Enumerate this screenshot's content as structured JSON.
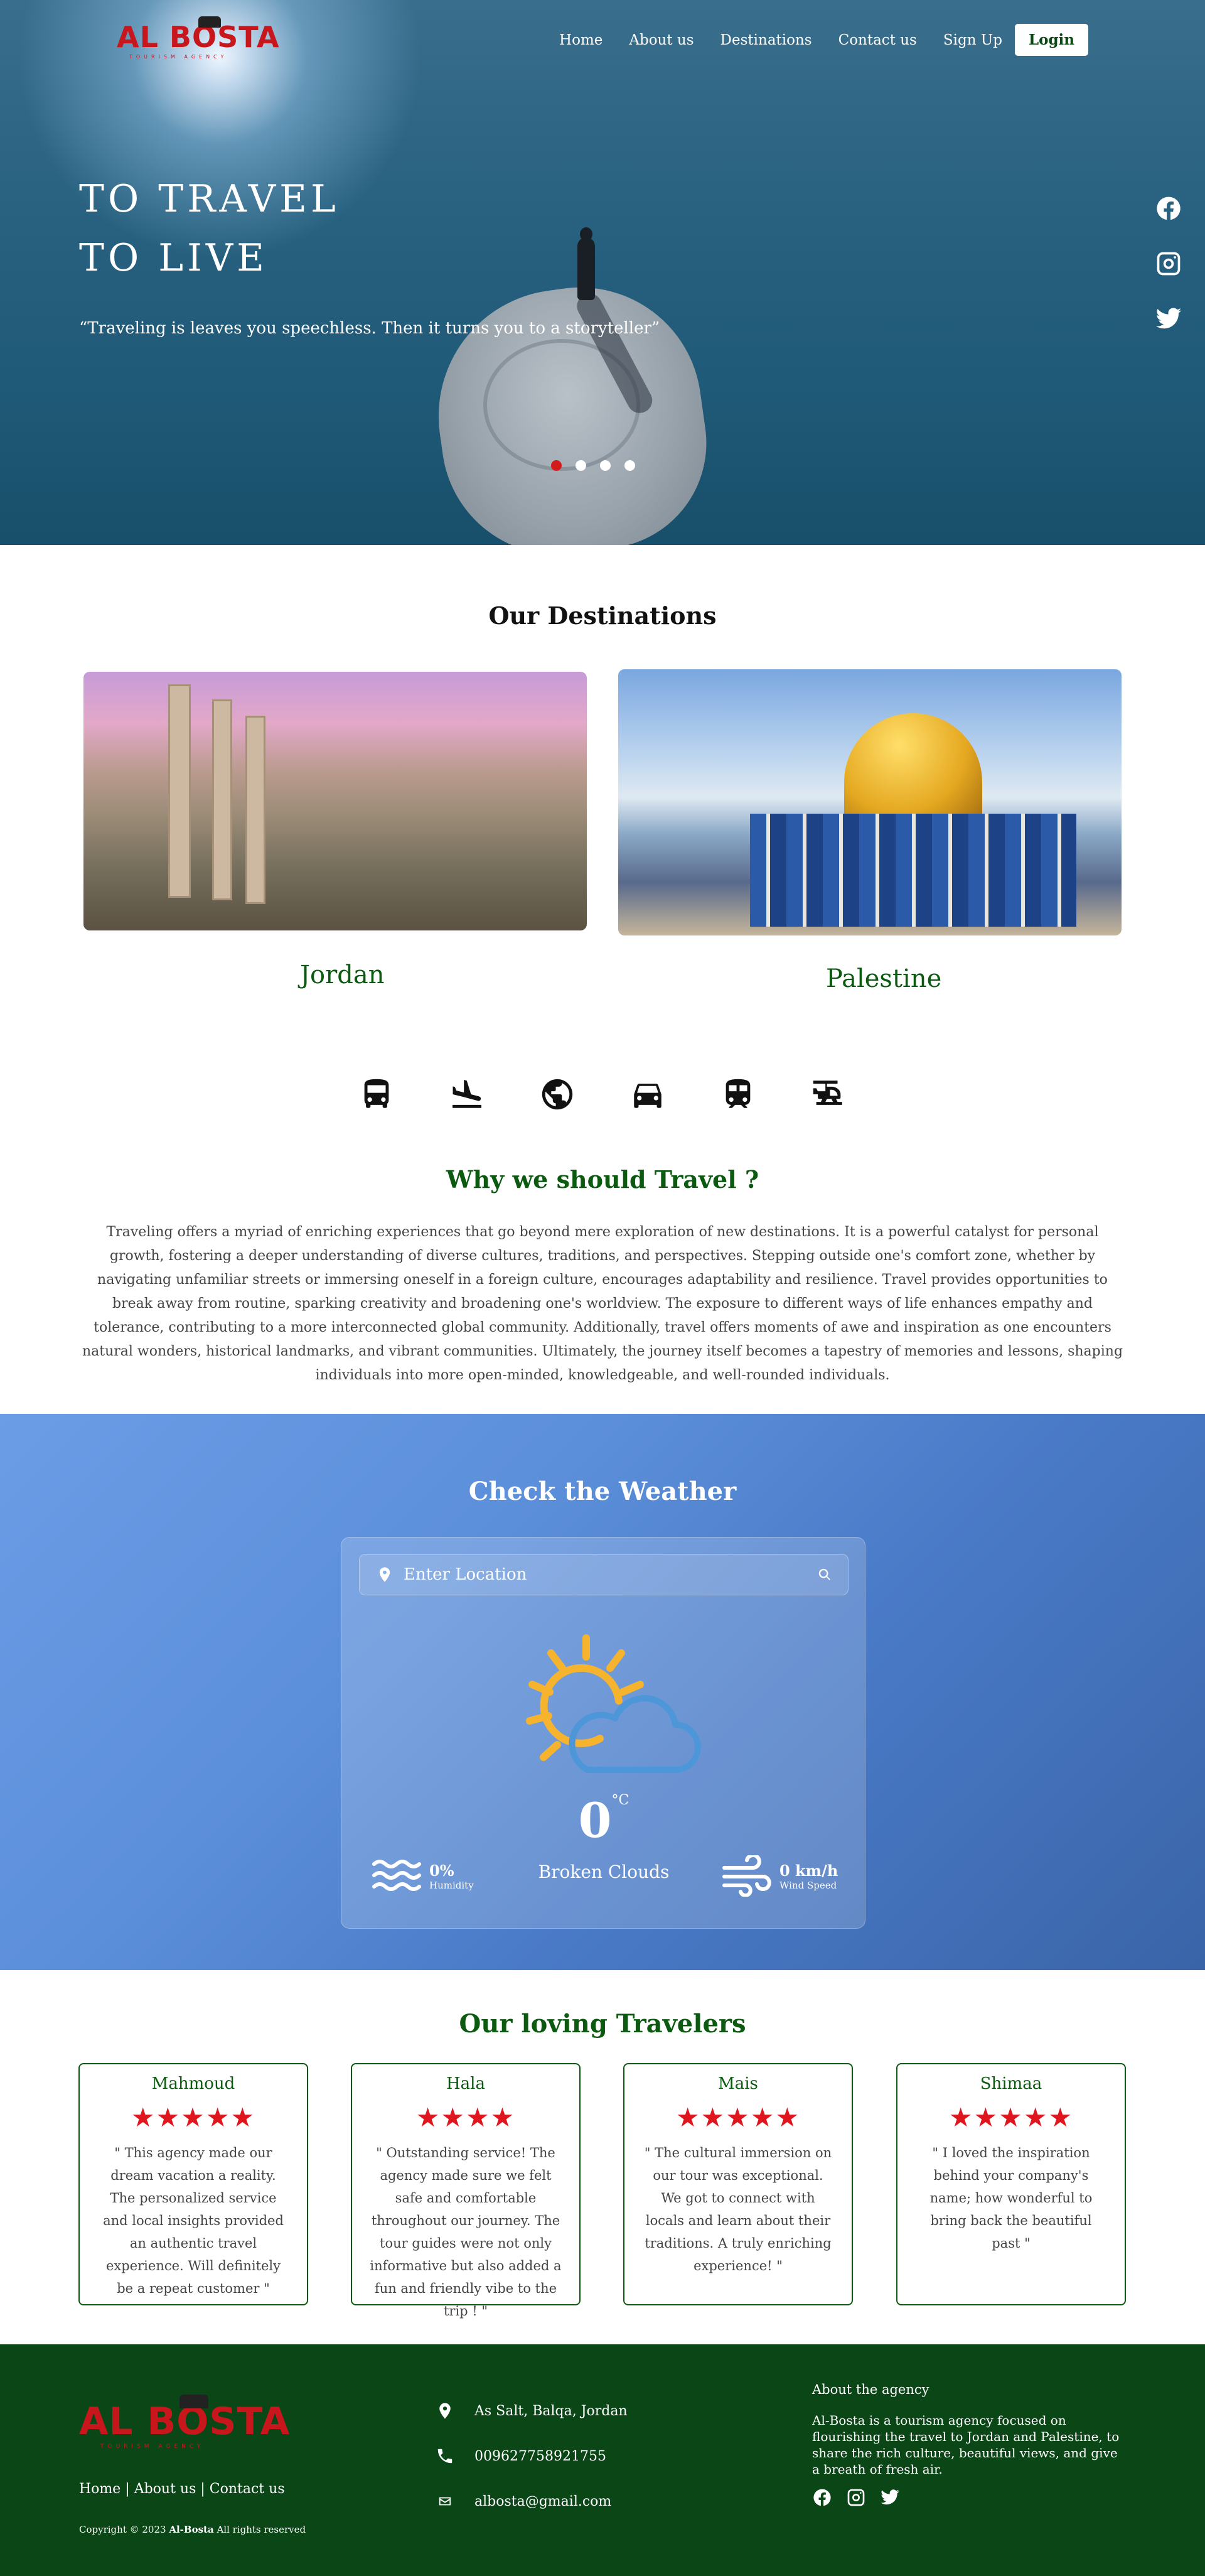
{
  "brand": {
    "name": "AL BOSTA",
    "tagline": "TOURISM AGENCY",
    "color": "#c8161d"
  },
  "nav": {
    "items": [
      "Home",
      "About us",
      "Destinations",
      "Contact us",
      "Sign Up"
    ],
    "login": "Login"
  },
  "hero": {
    "title_line1": "TO TRAVEL",
    "title_line2": "TO LIVE",
    "quote": "“Traveling is leaves you speechless. Then it turns you to a storyteller”",
    "slides": 4,
    "active_slide": 1,
    "socials": [
      "facebook-icon",
      "instagram-icon",
      "twitter-icon"
    ]
  },
  "destinations": {
    "title": "Our Destinations",
    "items": [
      {
        "label": "Jordan"
      },
      {
        "label": "Palestine"
      }
    ]
  },
  "transport_icons": [
    "bus-icon",
    "plane-landing-icon",
    "globe-icon",
    "car-icon",
    "train-icon",
    "helicopter-icon"
  ],
  "why": {
    "title": "Why we should Travel ?",
    "text": "Traveling offers a myriad of enriching experiences that go beyond mere exploration of new destinations. It is a powerful catalyst for personal growth, fostering a deeper understanding of diverse cultures, traditions, and perspectives. Stepping outside one's comfort zone, whether by navigating unfamiliar streets or immersing oneself in a foreign culture, encourages adaptability and resilience. Travel provides opportunities to break away from routine, sparking creativity and broadening one's worldview. The exposure to different ways of life enhances empathy and tolerance, contributing to a more interconnected global community. Additionally, travel offers moments of awe and inspiration as one encounters natural wonders, historical landmarks, and vibrant communities. Ultimately, the journey itself becomes a tapestry of memories and lessons, shaping individuals into more open-minded, knowledgeable, and well-rounded individuals."
  },
  "weather": {
    "title": "Check the Weather",
    "search_placeholder": "Enter Location",
    "temp": "0",
    "unit": "°C",
    "description": "Broken Clouds",
    "humidity": "0%",
    "humidity_label": "Humidity",
    "wind": "0 km/h",
    "wind_label": "Wind Speed"
  },
  "travelers": {
    "title": "Our loving Travelers",
    "reviews": [
      {
        "name": "Mahmoud",
        "rating": 5,
        "stars": "★★★★★",
        "text": "\" This agency made our dream vacation a reality. The personalized service and local insights provided an authentic travel experience. Will definitely be a repeat customer \""
      },
      {
        "name": "Hala",
        "rating": 4,
        "stars": "★★★★",
        "text": "\" Outstanding service! The agency made sure we felt safe and comfortable throughout our journey. The tour guides were not only informative but also added a fun and friendly vibe to the trip ! \""
      },
      {
        "name": "Mais",
        "rating": 5,
        "stars": "★★★★★",
        "text": "\" The cultural immersion on our tour was exceptional. We got to connect with locals and learn about their traditions. A truly enriching experience! \""
      },
      {
        "name": "Shimaa",
        "rating": 5,
        "stars": "★★★★★",
        "text": "\" I loved the inspiration behind your company's name; how wonderful to bring back the beautiful past \""
      }
    ]
  },
  "footer": {
    "links": "Home | About us | Contact us",
    "copyright_prefix": "Copyright © 2023 ",
    "copyright_brand": "Al-Bosta",
    "copyright_suffix": " All rights reserved",
    "address": "As Salt, Balqa, Jordan",
    "phone": "009627758921755",
    "email": "albosta@gmail.com",
    "about_title": "About the agency",
    "about_text": "Al-Bosta is a tourism agency focused on flourishing the travel to Jordan and Palestine, to share the rich culture, beautiful views, and give a breath of fresh air."
  }
}
